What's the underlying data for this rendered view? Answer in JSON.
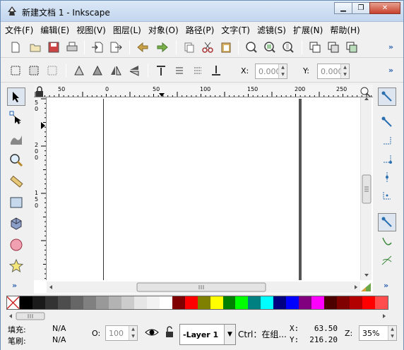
{
  "window": {
    "title": "新建文档 1 - Inkscape",
    "minimize": "▁",
    "restore": "❐",
    "close": "✕"
  },
  "menu": [
    "文件(F)",
    "编辑(E)",
    "视图(V)",
    "图层(L)",
    "对象(O)",
    "路径(P)",
    "文字(T)",
    "滤镜(S)",
    "扩展(N)",
    "帮助(H)"
  ],
  "toolbar": {
    "more": "»"
  },
  "toolctrl": {
    "x_label": "X:",
    "x_value": "0.000",
    "y_label": "Y:",
    "y_value": "0.000"
  },
  "ruler": {
    "h_ticks": [
      "50",
      "0",
      "50",
      "100",
      "150",
      "200",
      "250"
    ],
    "v_ticks": [
      "5",
      "0",
      "2",
      "0",
      "0",
      "1",
      "5",
      "0"
    ]
  },
  "palette": [
    "#000000",
    "#1a1a1a",
    "#333333",
    "#4d4d4d",
    "#666666",
    "#808080",
    "#999999",
    "#b3b3b3",
    "#cccccc",
    "#e6e6e6",
    "#f2f2f2",
    "#ffffff",
    "#800000",
    "#ff0000",
    "#808000",
    "#ffff00",
    "#008000",
    "#00ff00",
    "#008080",
    "#00ffff",
    "#000080",
    "#0000ff",
    "#800080",
    "#ff00ff",
    "#4d0000",
    "#800000",
    "#b30000",
    "#ff0000",
    "#ff4d4d"
  ],
  "status": {
    "fill_label": "填充:",
    "fill_value": "N/A",
    "stroke_label": "笔刷:",
    "stroke_value": "N/A",
    "opacity_label": "O:",
    "opacity_value": "100",
    "layer": "-Layer 1",
    "message": "Ctrl：在组...",
    "x_label": "X:",
    "x_value": "63.50",
    "y_label": "Y:",
    "y_value": "216.20",
    "z_label": "Z:",
    "zoom": "35%"
  }
}
